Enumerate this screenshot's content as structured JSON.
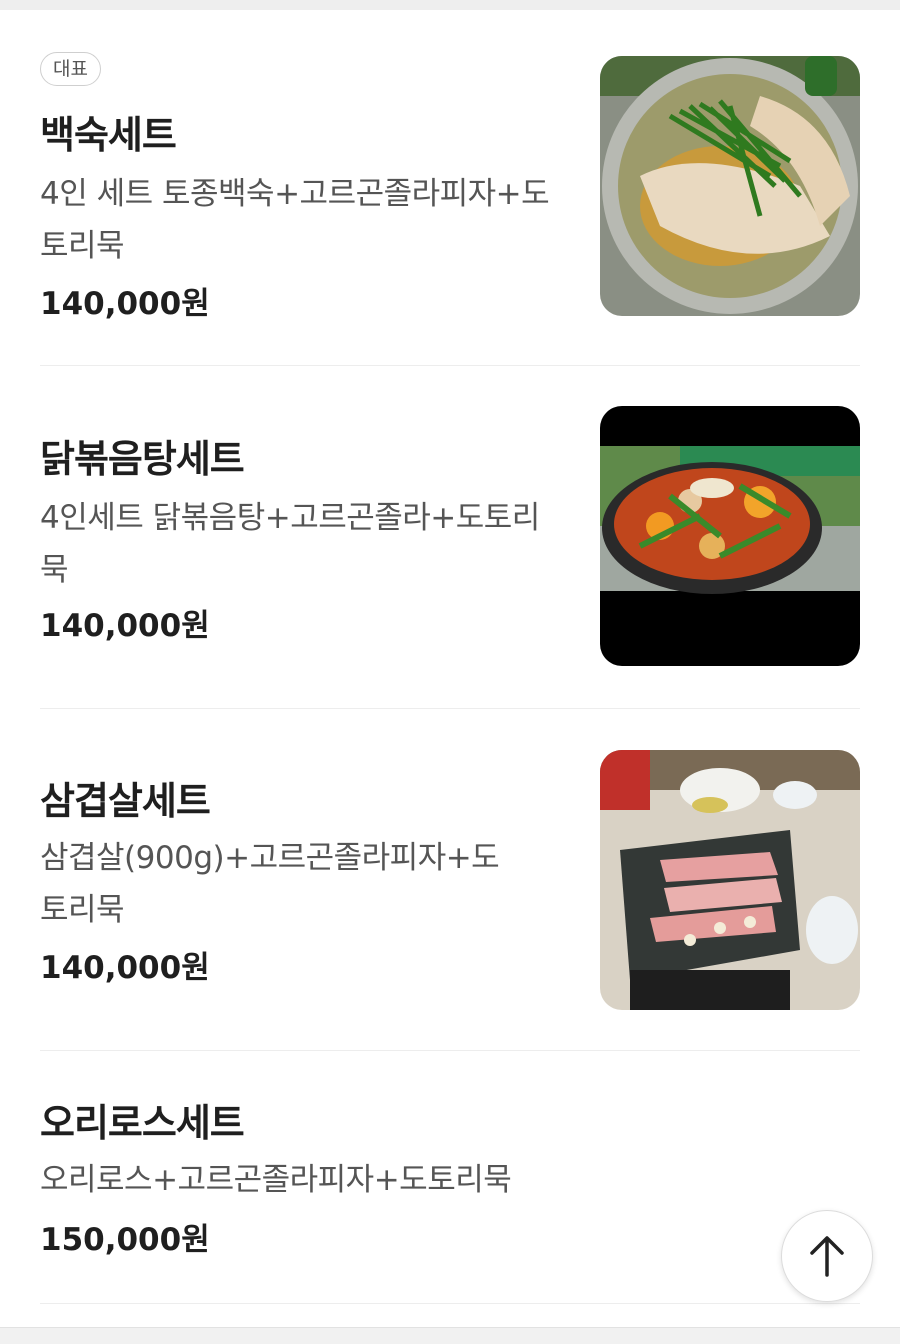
{
  "items": [
    {
      "badge": "대표",
      "name": "백숙세트",
      "description": "4인 세트 토종백숙+고르곤졸라피자+도토리묵",
      "price": "140,000원",
      "image_icon": "baeksuk-photo"
    },
    {
      "name": "닭볶음탕세트",
      "description": "4인세트 닭볶음탕+고르곤졸라+도토리묵",
      "price": "140,000원",
      "image_icon": "dakbokkeumtang-photo"
    },
    {
      "name": "삼겹살세트",
      "description": "삼겹살(900g)+고르곤졸라피자+도토리묵",
      "price": "140,000원",
      "image_icon": "samgyeopsal-photo"
    },
    {
      "name": "오리로스세트",
      "description": "오리로스+고르곤졸라피자+도토리묵",
      "price": "150,000원"
    }
  ],
  "scroll_top_icon": "arrow-up-icon"
}
